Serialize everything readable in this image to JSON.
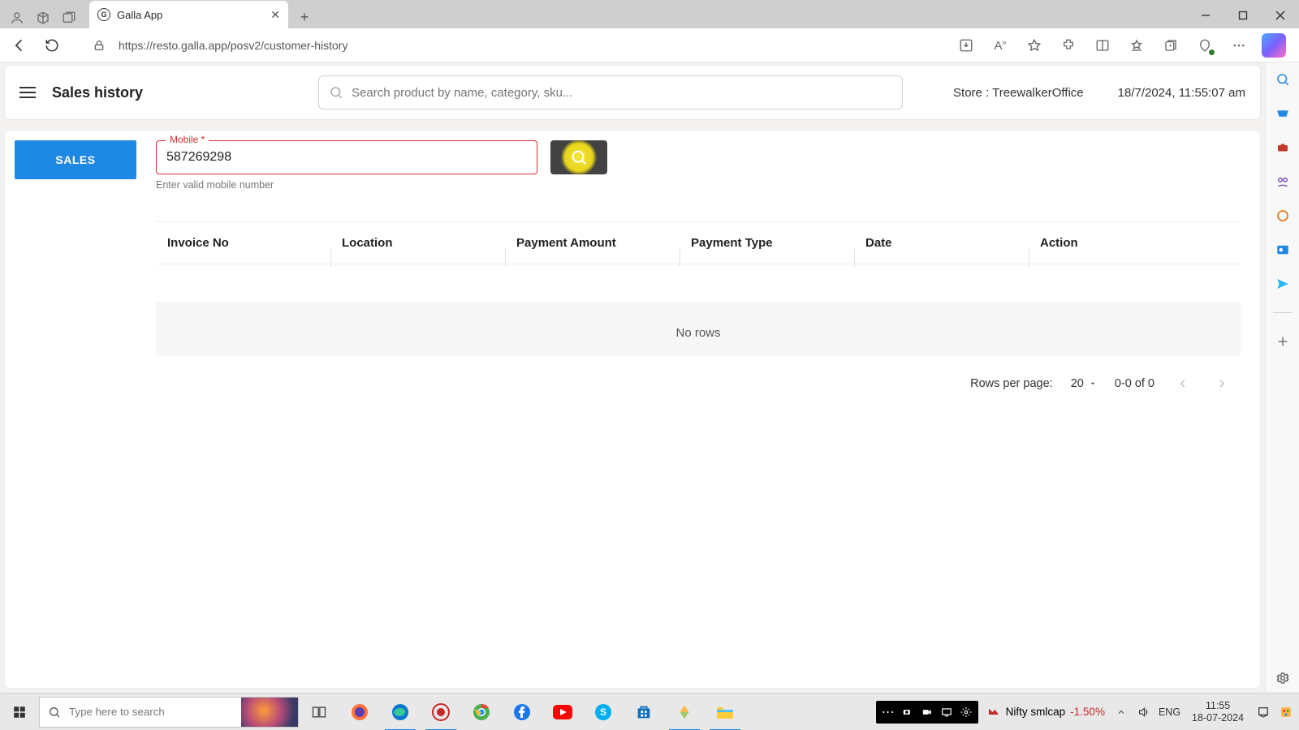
{
  "browser": {
    "tab_title": "Galla App",
    "url": "https://resto.galla.app/posv2/customer-history"
  },
  "app_header": {
    "title": "Sales history",
    "search_placeholder": "Search product by name, category, sku...",
    "store": "Store : TreewalkerOffice",
    "datetime": "18/7/2024, 11:55:07 am"
  },
  "tabs": {
    "sales": "SALES"
  },
  "mobile_field": {
    "legend": "Mobile *",
    "value": "587269298",
    "helper": "Enter valid mobile number"
  },
  "grid": {
    "columns": [
      "Invoice No",
      "Location",
      "Payment Amount",
      "Payment Type",
      "Date",
      "Action"
    ],
    "no_rows": "No rows"
  },
  "pagination": {
    "label": "Rows per page:",
    "value": "20",
    "range": "0-0 of 0"
  },
  "taskbar": {
    "search_placeholder": "Type here to search",
    "stock_name": "Nifty smlcap",
    "stock_change": "-1.50%",
    "lang": "ENG",
    "time": "11:55",
    "date": "18-07-2024"
  }
}
